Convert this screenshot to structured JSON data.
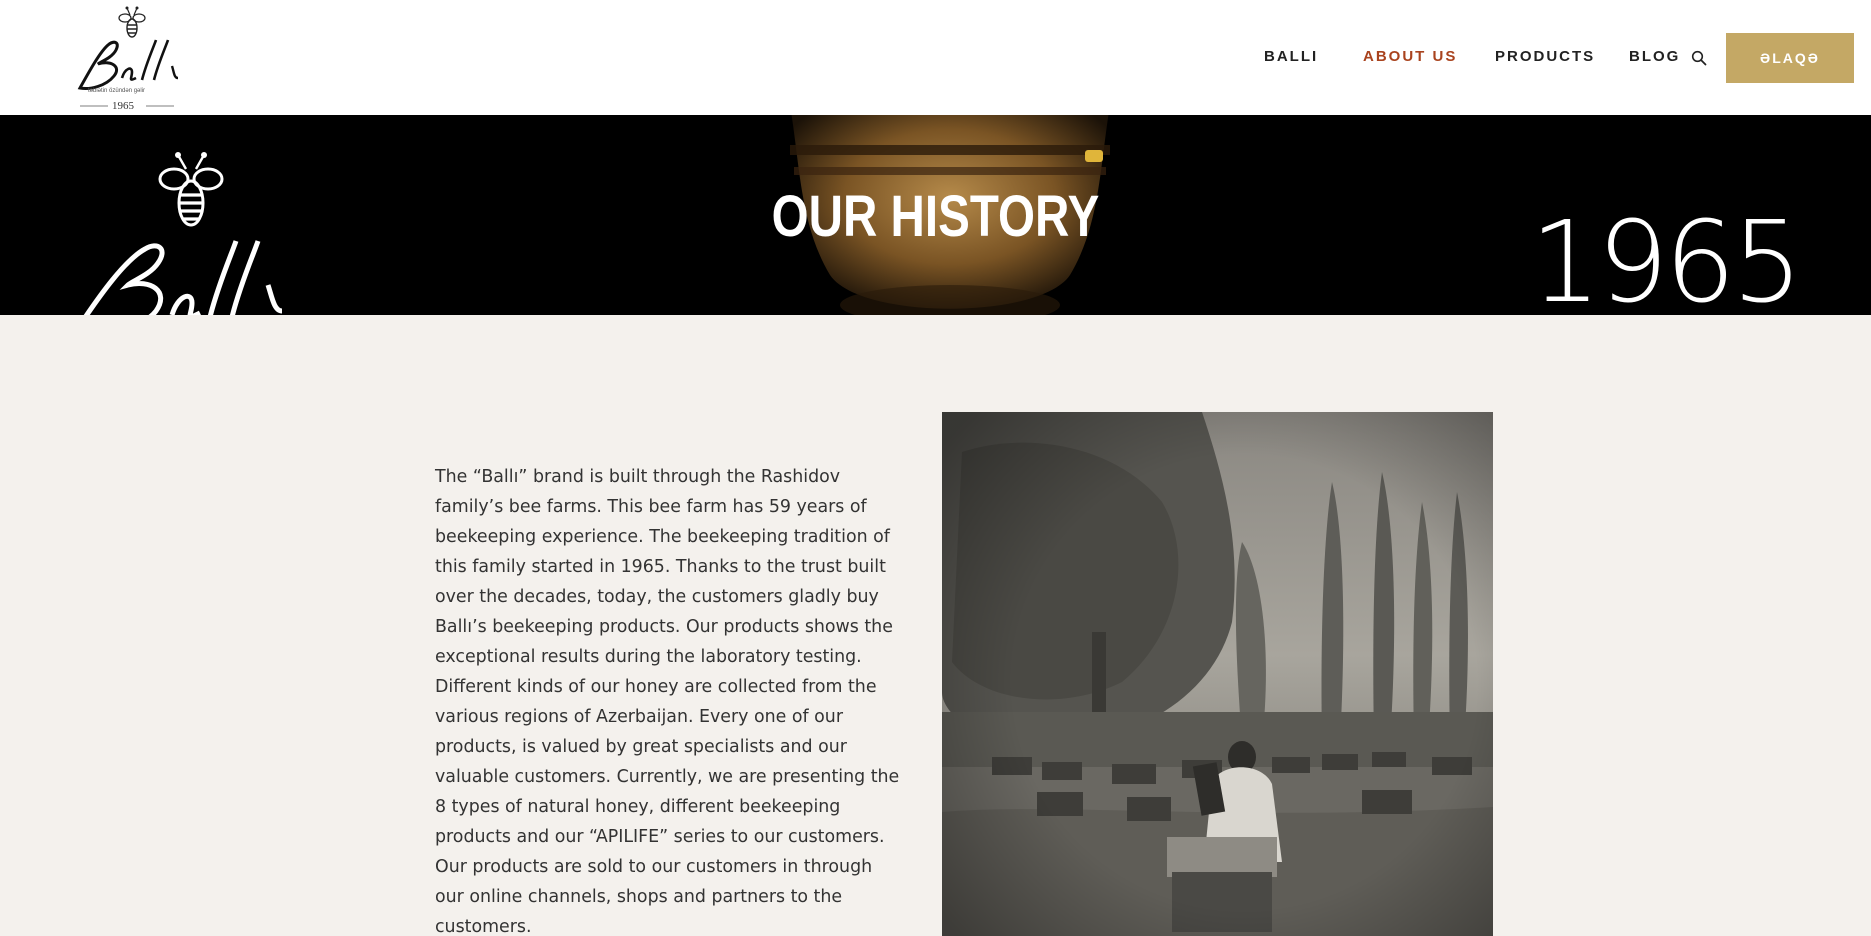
{
  "header": {
    "logo": {
      "wordmark": "Ballı",
      "tagline": "təbiətin özündən gəlir",
      "year": "1965"
    },
    "nav": [
      {
        "label": "BALLI",
        "active": false
      },
      {
        "label": "ABOUT US",
        "active": true
      },
      {
        "label": "PRODUCTS",
        "active": false
      },
      {
        "label": "BLOG",
        "active": false
      }
    ],
    "search_icon": "search-icon",
    "cta_label": "ƏLAQƏ"
  },
  "hero": {
    "title": "OUR HISTORY",
    "year": "1965",
    "logo_wordmark": "Ballı"
  },
  "main": {
    "paragraph": "The “Ballı” brand is built through the Rashidov family’s bee farms. This bee farm has 59 years of beekeeping experience. The beekeeping tradition of this family started in 1965. Thanks to the trust built over the decades, today, the customers gladly buy Ballı’s beekeeping products. Our products shows the exceptional results during the laboratory testing. Different kinds of our honey are collected from the various regions of Azerbaijan. Every one of our products, is valued by great specialists and our valuable customers. Currently, we are presenting the 8 types of natural honey, different beekeeping products and our “APILIFE” series to our customers. Our products are sold to our customers in through our online channels, shops and partners to the customers."
  },
  "colors": {
    "accent": "#c4a865",
    "active_nav": "#a9431e",
    "page_bg": "#f4f1ed",
    "hero_bg": "#000000"
  }
}
